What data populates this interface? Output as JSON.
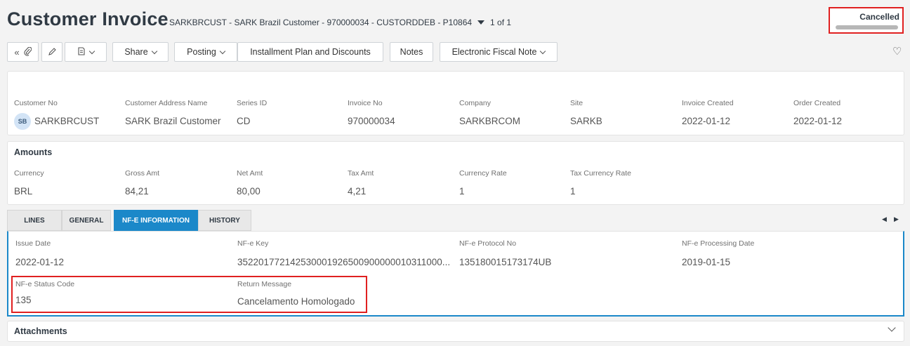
{
  "header": {
    "title": "Customer Invoice",
    "subtitle": "SARKBRCUST - SARK Brazil Customer - 970000034 - CUSTORDDEB - P10864",
    "record_count": "1 of 1",
    "status": "Cancelled"
  },
  "toolbar": {
    "share": "Share",
    "posting": "Posting",
    "installment": "Installment Plan and Discounts",
    "notes": "Notes",
    "fiscal_note": "Electronic Fiscal Note"
  },
  "customer": {
    "fields": [
      {
        "label": "Customer No",
        "value": "SARKBRCUST",
        "avatar": "SB"
      },
      {
        "label": "Customer Address Name",
        "value": "SARK Brazil Customer"
      },
      {
        "label": "Series ID",
        "value": "CD"
      },
      {
        "label": "Invoice No",
        "value": "970000034"
      },
      {
        "label": "Company",
        "value": "SARKBRCOM"
      },
      {
        "label": "Site",
        "value": "SARKB"
      },
      {
        "label": "Invoice Created",
        "value": "2022-01-12"
      },
      {
        "label": "Order Created",
        "value": "2022-01-12"
      }
    ]
  },
  "amounts": {
    "title": "Amounts",
    "fields": [
      {
        "label": "Currency",
        "value": "BRL"
      },
      {
        "label": "Gross Amt",
        "value": "84,21"
      },
      {
        "label": "Net Amt",
        "value": "80,00"
      },
      {
        "label": "Tax Amt",
        "value": "4,21"
      },
      {
        "label": "Currency Rate",
        "value": "1"
      },
      {
        "label": "Tax Currency Rate",
        "value": "1"
      }
    ]
  },
  "tabs": [
    "LINES",
    "GENERAL",
    "NF-E INFORMATION",
    "HISTORY"
  ],
  "nfe": {
    "issue_date_label": "Issue Date",
    "issue_date": "2022-01-12",
    "key_label": "NF-e Key",
    "key": "352201772142530001926500900000010311000...",
    "protocol_label": "NF-e Protocol No",
    "protocol": "135180015173174UB",
    "processing_label": "NF-e Processing Date",
    "processing": "2019-01-15",
    "status_code_label": "NF-e Status Code",
    "status_code": "135",
    "return_msg_label": "Return Message",
    "return_msg": "Cancelamento Homologado"
  },
  "attachments": {
    "title": "Attachments"
  },
  "colors": {
    "accent": "#1b88c9",
    "highlight": "#e02020"
  },
  "icons": [
    "collapse-icon",
    "paperclip-icon",
    "edit-icon",
    "document-icon",
    "favorite-icon"
  ]
}
